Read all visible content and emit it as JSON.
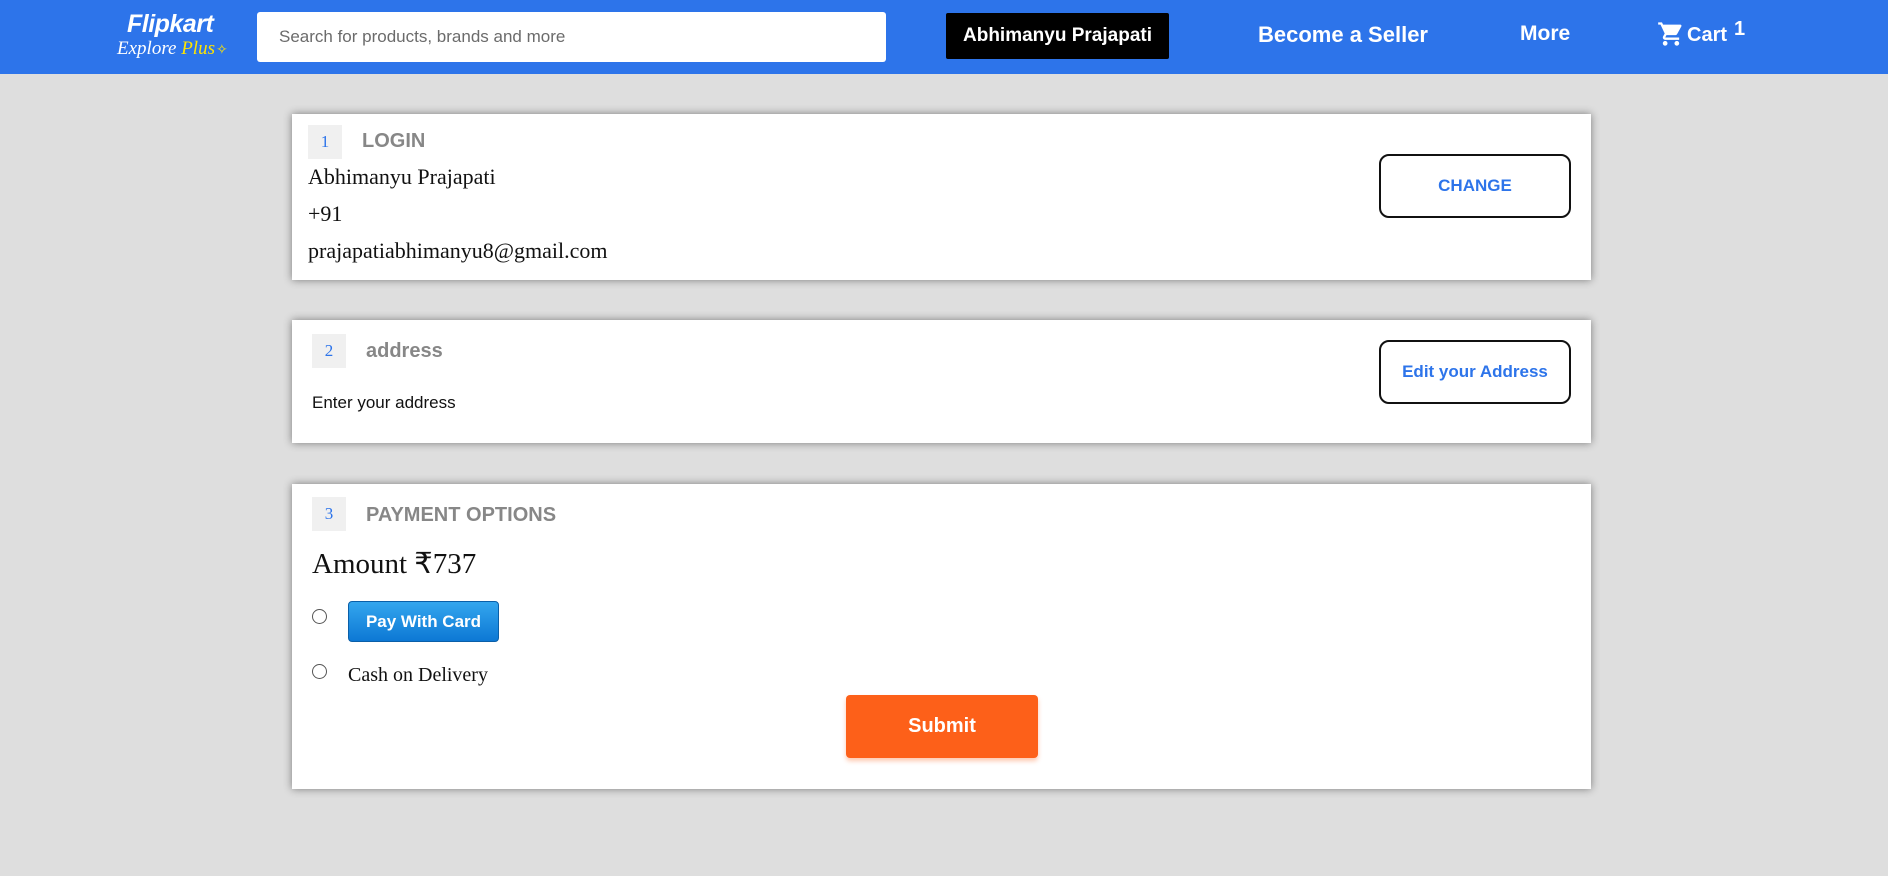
{
  "brand": {
    "name": "Flipkart",
    "tagline_prefix": "Explore",
    "tagline_plus": "Plus",
    "plus_glyph": "✧",
    "header_color": "#2d74ea"
  },
  "search": {
    "placeholder": "Search for products, brands and more",
    "value": "",
    "icon": "search-icon"
  },
  "nav": {
    "user_name": "Abhimanyu Prajapati",
    "become_seller": "Become a Seller",
    "more": "More",
    "cart_label": "Cart",
    "cart_count": "1",
    "cart_icon": "cart-icon"
  },
  "login": {
    "step": "1",
    "title": "LOGIN",
    "name": "Abhimanyu Prajapati",
    "phone": "+91",
    "email": "prajapatiabhimanyu8@gmail.com",
    "change_label": "CHANGE"
  },
  "address": {
    "step": "2",
    "title": "address",
    "text": "Enter your address",
    "edit_label": "Edit your Address"
  },
  "payment": {
    "step": "3",
    "title": "PAYMENT OPTIONS",
    "amount": "Amount ₹737",
    "card_label": "Pay With Card",
    "cod_label": "Cash on Delivery",
    "submit_label": "Submit",
    "submit_color": "#fd6019"
  }
}
